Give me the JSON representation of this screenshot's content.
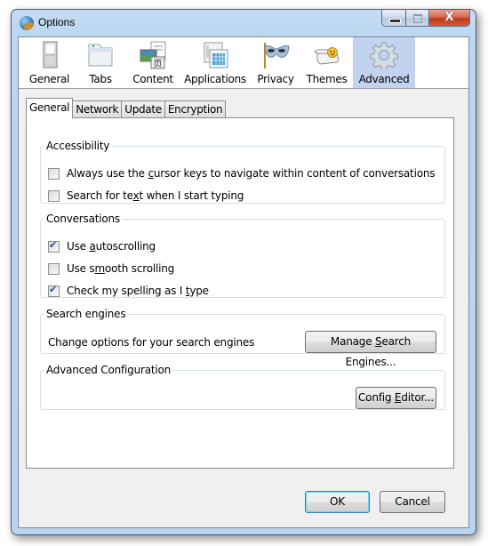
{
  "window": {
    "title": "Options",
    "app_icon": "app-globe-icon",
    "caption_buttons": [
      "minimize",
      "maximize",
      "close"
    ],
    "close_glyph": "X"
  },
  "toolbar": {
    "items": [
      {
        "label": "General",
        "icon": "switch-icon",
        "active": false
      },
      {
        "label": "Tabs",
        "icon": "tabs-icon",
        "active": false
      },
      {
        "label": "Content",
        "icon": "content-icon",
        "active": false
      },
      {
        "label": "Applications",
        "icon": "applications-icon",
        "active": false
      },
      {
        "label": "Privacy",
        "icon": "mask-icon",
        "active": false
      },
      {
        "label": "Themes",
        "icon": "smiley-bubble-icon",
        "active": false
      },
      {
        "label": "Advanced",
        "icon": "gear-icon",
        "active": true
      }
    ]
  },
  "tabs": [
    {
      "label": "General",
      "active": true
    },
    {
      "label": "Network",
      "active": false
    },
    {
      "label": "Update",
      "active": false
    },
    {
      "label": "Encryption",
      "active": false
    }
  ],
  "groups": {
    "accessibility": {
      "legend": "Accessibility",
      "options": [
        {
          "pre": "Always use the ",
          "key": "c",
          "post": "ursor keys to navigate within content of conversations",
          "checked": false
        },
        {
          "pre": "Search for te",
          "key": "x",
          "post": "t when I start typing",
          "checked": false
        }
      ]
    },
    "conversations": {
      "legend": "Conversations",
      "options": [
        {
          "pre": "Use ",
          "key": "a",
          "post": "utoscrolling",
          "checked": true
        },
        {
          "pre": "Use s",
          "key": "m",
          "post": "ooth scrolling",
          "checked": false
        },
        {
          "pre": "Check my spelling as I ",
          "key": "t",
          "post": "ype",
          "checked": true
        }
      ]
    },
    "search_engines": {
      "legend": "Search engines",
      "description": "Change options for your search engines",
      "button": {
        "pre": "Manage ",
        "key": "S",
        "post": "earch Engines..."
      }
    },
    "advanced_config": {
      "legend": "Advanced Configuration",
      "button": {
        "pre": "Config ",
        "key": "E",
        "post": "ditor..."
      }
    }
  },
  "footer": {
    "ok_label": "OK",
    "cancel_label": "Cancel"
  }
}
